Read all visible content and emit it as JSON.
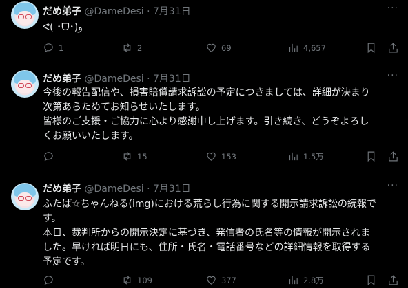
{
  "tweets": [
    {
      "author": "だめ弟子",
      "handle": "@DameDesi",
      "dot": "·",
      "date": "7月31日",
      "more": "···",
      "lines": [
        "ᕙ( ･ᗜ･)و"
      ],
      "replies": "1",
      "retweets": "2",
      "likes": "69",
      "views": "4,657"
    },
    {
      "author": "だめ弟子",
      "handle": "@DameDesi",
      "dot": "·",
      "date": "7月31日",
      "more": "···",
      "lines": [
        "今後の報告配信や、損害賠償請求訴訟の予定につきましては、詳細が決まり",
        "次第あらためてお知らせいたします。",
        "皆様のご支援・ご協力に心より感謝申し上げます。引き続き、どうぞよろし",
        "くお願いいたします。"
      ],
      "replies": "",
      "retweets": "15",
      "likes": "153",
      "views": "1.5万"
    },
    {
      "author": "だめ弟子",
      "handle": "@DameDesi",
      "dot": "·",
      "date": "7月31日",
      "more": "···",
      "lines": [
        "ふたば☆ちゃんねる(img)における荒らし行為に関する開示請求訴訟の続報で",
        "す。",
        "本日、裁判所からの開示決定に基づき、発信者の氏名等の情報が開示されま",
        "した。早ければ明日にも、住所・氏名・電話番号などの詳細情報を取得する",
        "予定です。"
      ],
      "replies": "",
      "retweets": "109",
      "likes": "377",
      "views": "2.8万"
    }
  ],
  "icons": {
    "reply": "reply-icon",
    "retweet": "retweet-icon",
    "like": "heart-icon",
    "views": "views-icon",
    "bookmark": "bookmark-icon",
    "share": "share-icon"
  },
  "colors": {
    "background": "#000000",
    "text": "#e7e9ea",
    "muted": "#71767b",
    "divider": "#2f3336"
  }
}
